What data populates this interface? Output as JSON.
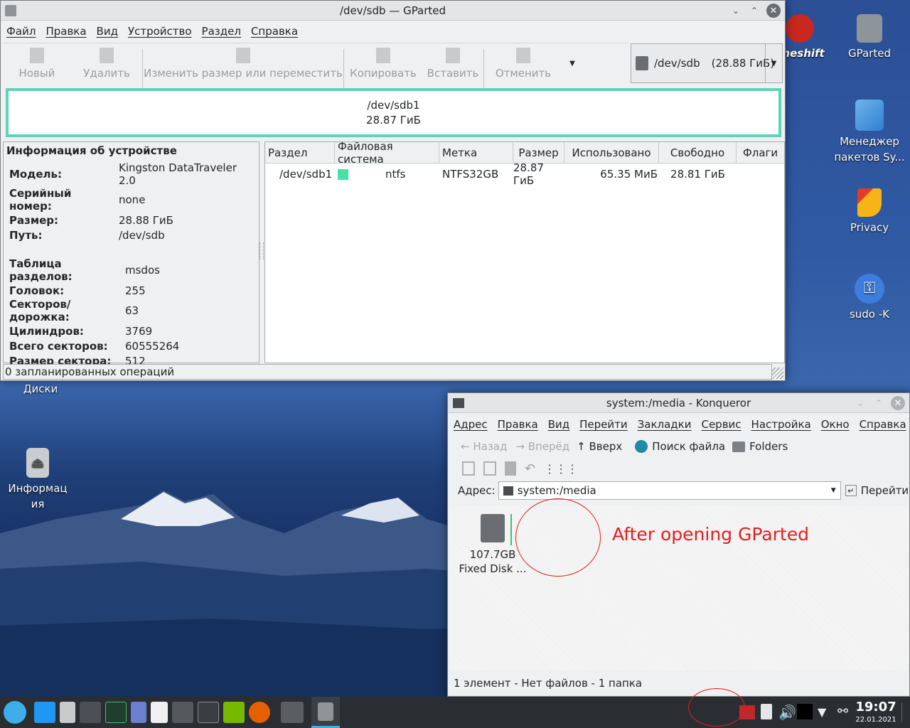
{
  "desktop": {
    "icons": [
      {
        "name": "eheshift",
        "label": "eheshift"
      },
      {
        "name": "gparted",
        "label": "GParted"
      },
      {
        "name": "package-manager",
        "label": "Менеджер пакетов Sy..."
      },
      {
        "name": "privacy",
        "label": "Privacy"
      },
      {
        "name": "sudo",
        "label": "sudo -K"
      },
      {
        "name": "disks",
        "label": "Диски"
      },
      {
        "name": "info",
        "label": "Информация"
      }
    ]
  },
  "gparted": {
    "title": "/dev/sdb — GParted",
    "menu": [
      "Файл",
      "Правка",
      "Вид",
      "Устройство",
      "Раздел",
      "Справка"
    ],
    "toolbar": {
      "new": "Новый",
      "delete": "Удалить",
      "resize": "Изменить размер или переместить",
      "copy": "Копировать",
      "paste": "Вставить",
      "undo": "Отменить"
    },
    "device_selector": {
      "device": "/dev/sdb",
      "size": "(28.88 ГиБ)"
    },
    "graph": {
      "partition": "/dev/sdb1",
      "size": "28.87 ГиБ"
    },
    "device_info": {
      "heading": "Информация об устройстве",
      "rows": [
        {
          "k": "Модель:",
          "v": "Kingston DataTraveler 2.0"
        },
        {
          "k": "Серийный номер:",
          "v": "none"
        },
        {
          "k": "Размер:",
          "v": "28.88 ГиБ"
        },
        {
          "k": "Путь:",
          "v": "/dev/sdb"
        }
      ],
      "rows2": [
        {
          "k": "Таблица разделов:",
          "v": "msdos"
        },
        {
          "k": "Головок:",
          "v": "255"
        },
        {
          "k": "Секторов/дорожка:",
          "v": "63"
        },
        {
          "k": "Цилиндров:",
          "v": "3769"
        },
        {
          "k": "Всего секторов:",
          "v": "60555264"
        },
        {
          "k": "Размер сектора:",
          "v": "512"
        }
      ]
    },
    "columns": [
      "Раздел",
      "Файловая система",
      "Метка",
      "Размер",
      "Использовано",
      "Свободно",
      "Флаги"
    ],
    "partitions": [
      {
        "name": "/dev/sdb1",
        "fs": "ntfs",
        "fs_color": "#47e0a7",
        "label": "NTFS32GB",
        "size": "28.87 ГиБ",
        "used": "65.35 МиБ",
        "free": "28.81 ГиБ",
        "flags": ""
      }
    ],
    "status": "0 запланированных операций"
  },
  "konqueror": {
    "title": "system:/media - Konqueror",
    "menu": [
      "Адрес",
      "Правка",
      "Вид",
      "Перейти",
      "Закладки",
      "Сервис",
      "Настройка",
      "Окно",
      "Справка"
    ],
    "toolbar": {
      "back": "Назад",
      "forward": "Вперёд",
      "up": "Вверх",
      "find": "Поиск файла",
      "folders": "Folders"
    },
    "address_label": "Адрес:",
    "address": "system:/media",
    "go": "Перейти",
    "items": [
      {
        "size": "107.7GB",
        "name": "Fixed Disk ..."
      }
    ],
    "annotation": "After opening GParted",
    "status": "1 элемент - Нет файлов - 1 папка"
  },
  "taskbar": {
    "time": "19:07",
    "date": "22.01.2021"
  },
  "colors": {
    "accent": "#3daee9",
    "partition_border": "#5fd3b5",
    "annotation": "#e02020"
  }
}
